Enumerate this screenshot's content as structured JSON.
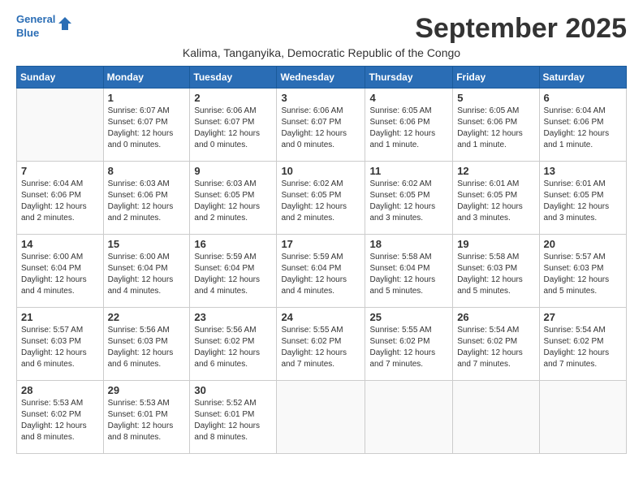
{
  "logo": {
    "line1": "General",
    "line2": "Blue"
  },
  "title": "September 2025",
  "subtitle": "Kalima, Tanganyika, Democratic Republic of the Congo",
  "headers": [
    "Sunday",
    "Monday",
    "Tuesday",
    "Wednesday",
    "Thursday",
    "Friday",
    "Saturday"
  ],
  "weeks": [
    [
      {
        "day": "",
        "sunrise": "",
        "sunset": "",
        "daylight": ""
      },
      {
        "day": "1",
        "sunrise": "Sunrise: 6:07 AM",
        "sunset": "Sunset: 6:07 PM",
        "daylight": "Daylight: 12 hours and 0 minutes."
      },
      {
        "day": "2",
        "sunrise": "Sunrise: 6:06 AM",
        "sunset": "Sunset: 6:07 PM",
        "daylight": "Daylight: 12 hours and 0 minutes."
      },
      {
        "day": "3",
        "sunrise": "Sunrise: 6:06 AM",
        "sunset": "Sunset: 6:07 PM",
        "daylight": "Daylight: 12 hours and 0 minutes."
      },
      {
        "day": "4",
        "sunrise": "Sunrise: 6:05 AM",
        "sunset": "Sunset: 6:06 PM",
        "daylight": "Daylight: 12 hours and 1 minute."
      },
      {
        "day": "5",
        "sunrise": "Sunrise: 6:05 AM",
        "sunset": "Sunset: 6:06 PM",
        "daylight": "Daylight: 12 hours and 1 minute."
      },
      {
        "day": "6",
        "sunrise": "Sunrise: 6:04 AM",
        "sunset": "Sunset: 6:06 PM",
        "daylight": "Daylight: 12 hours and 1 minute."
      }
    ],
    [
      {
        "day": "7",
        "sunrise": "Sunrise: 6:04 AM",
        "sunset": "Sunset: 6:06 PM",
        "daylight": "Daylight: 12 hours and 2 minutes."
      },
      {
        "day": "8",
        "sunrise": "Sunrise: 6:03 AM",
        "sunset": "Sunset: 6:06 PM",
        "daylight": "Daylight: 12 hours and 2 minutes."
      },
      {
        "day": "9",
        "sunrise": "Sunrise: 6:03 AM",
        "sunset": "Sunset: 6:05 PM",
        "daylight": "Daylight: 12 hours and 2 minutes."
      },
      {
        "day": "10",
        "sunrise": "Sunrise: 6:02 AM",
        "sunset": "Sunset: 6:05 PM",
        "daylight": "Daylight: 12 hours and 2 minutes."
      },
      {
        "day": "11",
        "sunrise": "Sunrise: 6:02 AM",
        "sunset": "Sunset: 6:05 PM",
        "daylight": "Daylight: 12 hours and 3 minutes."
      },
      {
        "day": "12",
        "sunrise": "Sunrise: 6:01 AM",
        "sunset": "Sunset: 6:05 PM",
        "daylight": "Daylight: 12 hours and 3 minutes."
      },
      {
        "day": "13",
        "sunrise": "Sunrise: 6:01 AM",
        "sunset": "Sunset: 6:05 PM",
        "daylight": "Daylight: 12 hours and 3 minutes."
      }
    ],
    [
      {
        "day": "14",
        "sunrise": "Sunrise: 6:00 AM",
        "sunset": "Sunset: 6:04 PM",
        "daylight": "Daylight: 12 hours and 4 minutes."
      },
      {
        "day": "15",
        "sunrise": "Sunrise: 6:00 AM",
        "sunset": "Sunset: 6:04 PM",
        "daylight": "Daylight: 12 hours and 4 minutes."
      },
      {
        "day": "16",
        "sunrise": "Sunrise: 5:59 AM",
        "sunset": "Sunset: 6:04 PM",
        "daylight": "Daylight: 12 hours and 4 minutes."
      },
      {
        "day": "17",
        "sunrise": "Sunrise: 5:59 AM",
        "sunset": "Sunset: 6:04 PM",
        "daylight": "Daylight: 12 hours and 4 minutes."
      },
      {
        "day": "18",
        "sunrise": "Sunrise: 5:58 AM",
        "sunset": "Sunset: 6:04 PM",
        "daylight": "Daylight: 12 hours and 5 minutes."
      },
      {
        "day": "19",
        "sunrise": "Sunrise: 5:58 AM",
        "sunset": "Sunset: 6:03 PM",
        "daylight": "Daylight: 12 hours and 5 minutes."
      },
      {
        "day": "20",
        "sunrise": "Sunrise: 5:57 AM",
        "sunset": "Sunset: 6:03 PM",
        "daylight": "Daylight: 12 hours and 5 minutes."
      }
    ],
    [
      {
        "day": "21",
        "sunrise": "Sunrise: 5:57 AM",
        "sunset": "Sunset: 6:03 PM",
        "daylight": "Daylight: 12 hours and 6 minutes."
      },
      {
        "day": "22",
        "sunrise": "Sunrise: 5:56 AM",
        "sunset": "Sunset: 6:03 PM",
        "daylight": "Daylight: 12 hours and 6 minutes."
      },
      {
        "day": "23",
        "sunrise": "Sunrise: 5:56 AM",
        "sunset": "Sunset: 6:02 PM",
        "daylight": "Daylight: 12 hours and 6 minutes."
      },
      {
        "day": "24",
        "sunrise": "Sunrise: 5:55 AM",
        "sunset": "Sunset: 6:02 PM",
        "daylight": "Daylight: 12 hours and 7 minutes."
      },
      {
        "day": "25",
        "sunrise": "Sunrise: 5:55 AM",
        "sunset": "Sunset: 6:02 PM",
        "daylight": "Daylight: 12 hours and 7 minutes."
      },
      {
        "day": "26",
        "sunrise": "Sunrise: 5:54 AM",
        "sunset": "Sunset: 6:02 PM",
        "daylight": "Daylight: 12 hours and 7 minutes."
      },
      {
        "day": "27",
        "sunrise": "Sunrise: 5:54 AM",
        "sunset": "Sunset: 6:02 PM",
        "daylight": "Daylight: 12 hours and 7 minutes."
      }
    ],
    [
      {
        "day": "28",
        "sunrise": "Sunrise: 5:53 AM",
        "sunset": "Sunset: 6:02 PM",
        "daylight": "Daylight: 12 hours and 8 minutes."
      },
      {
        "day": "29",
        "sunrise": "Sunrise: 5:53 AM",
        "sunset": "Sunset: 6:01 PM",
        "daylight": "Daylight: 12 hours and 8 minutes."
      },
      {
        "day": "30",
        "sunrise": "Sunrise: 5:52 AM",
        "sunset": "Sunset: 6:01 PM",
        "daylight": "Daylight: 12 hours and 8 minutes."
      },
      {
        "day": "",
        "sunrise": "",
        "sunset": "",
        "daylight": ""
      },
      {
        "day": "",
        "sunrise": "",
        "sunset": "",
        "daylight": ""
      },
      {
        "day": "",
        "sunrise": "",
        "sunset": "",
        "daylight": ""
      },
      {
        "day": "",
        "sunrise": "",
        "sunset": "",
        "daylight": ""
      }
    ]
  ]
}
